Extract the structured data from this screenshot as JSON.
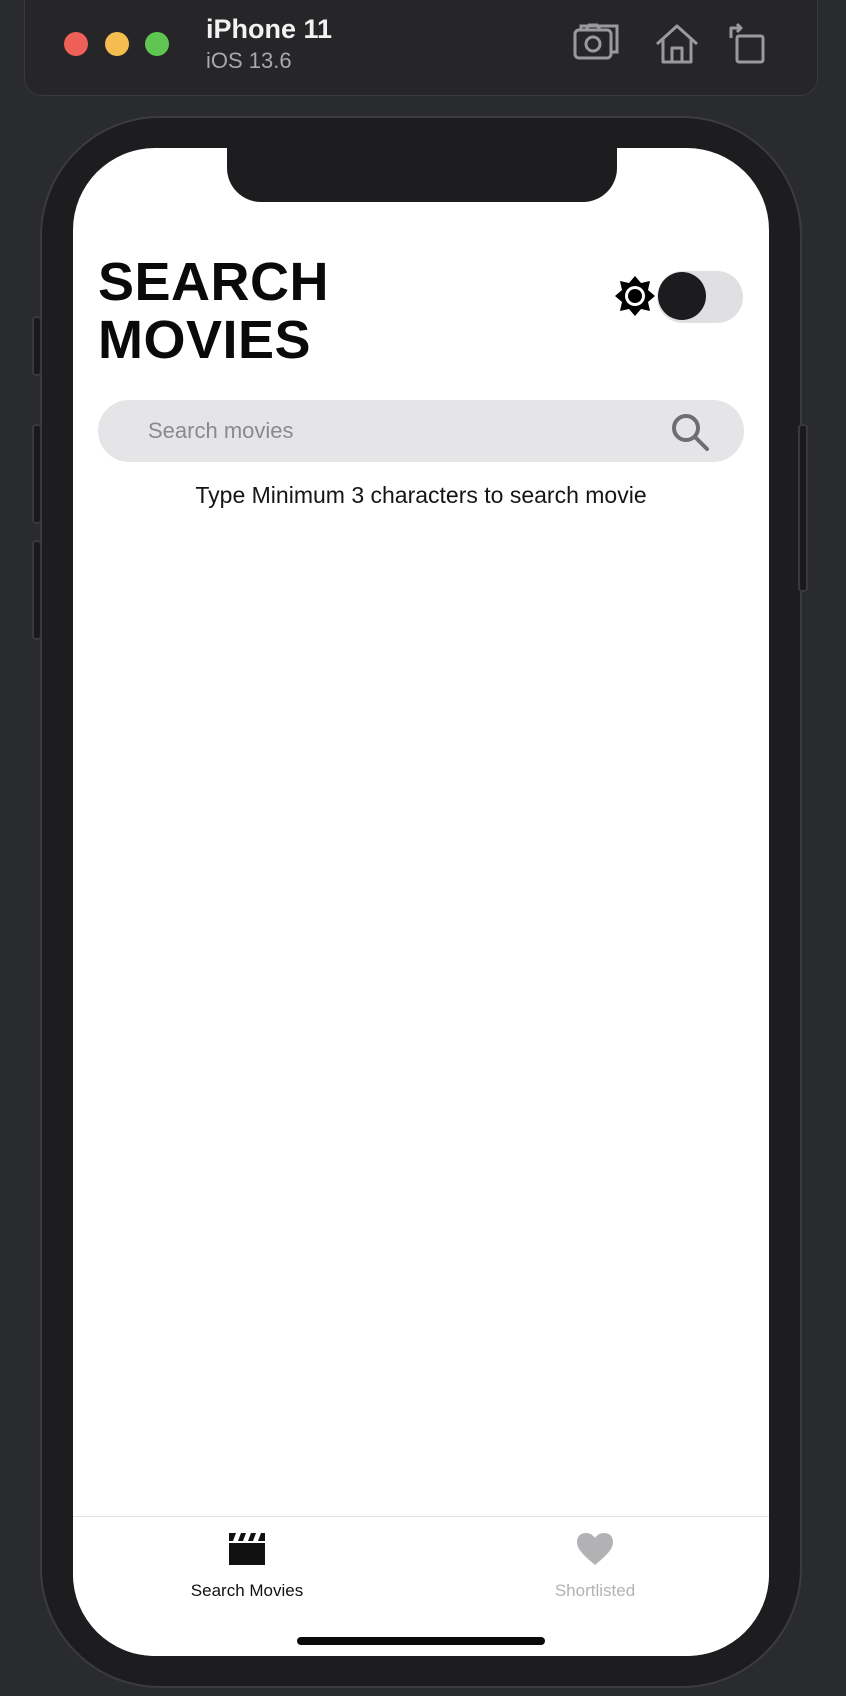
{
  "simulator": {
    "device_name": "iPhone 11",
    "os_version": "iOS 13.6",
    "icons": [
      "screenshot-icon",
      "home-icon",
      "rotate-icon"
    ]
  },
  "header": {
    "title_line1": "SEARCH",
    "title_line2": "MOVIES",
    "theme_icon": "brightness-icon",
    "dark_mode_toggle_on": false
  },
  "search": {
    "placeholder": "Search movies",
    "value": "",
    "icon": "search-icon"
  },
  "hint_text": "Type Minimum 3 characters to search movie",
  "tabs": [
    {
      "label": "Search Movies",
      "icon": "clapperboard-icon",
      "active": true
    },
    {
      "label": "Shortlisted",
      "icon": "heart-icon",
      "active": false
    }
  ],
  "colors": {
    "accent_active": "#111111",
    "tab_inactive": "#b2b2b4",
    "search_bg": "#e5e5e7"
  }
}
